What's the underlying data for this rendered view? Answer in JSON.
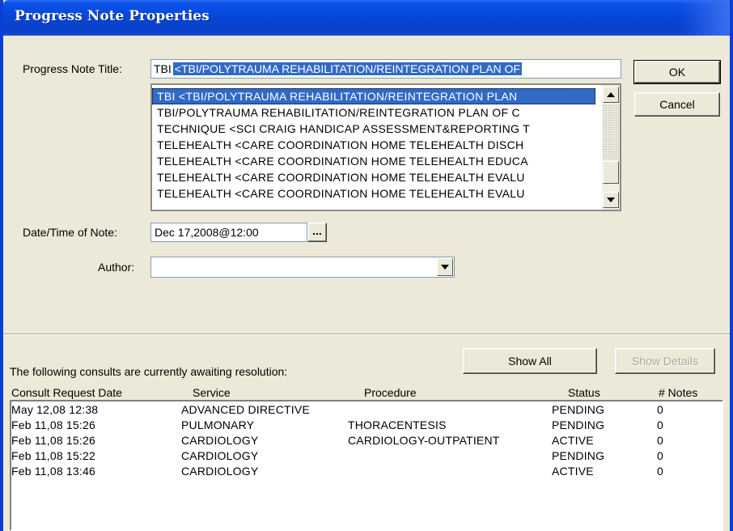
{
  "window": {
    "title": "Progress Note Properties"
  },
  "form": {
    "title_label": "Progress Note Title:",
    "title_typed": "TBI",
    "title_autocomplete": "<TBI/POLYTRAUMA REHABILITATION/REINTEGRATION PLAN OF",
    "title_options": [
      "TBI  <TBI/POLYTRAUMA REHABILITATION/REINTEGRATION PLAN",
      "TBI/POLYTRAUMA REHABILITATION/REINTEGRATION PLAN OF C",
      "TECHNIQUE  <SCI CRAIG HANDICAP ASSESSMENT&REPORTING T",
      "TELEHEALTH  <CARE COORDINATION HOME TELEHEALTH DISCH",
      "TELEHEALTH  <CARE COORDINATION HOME TELEHEALTH EDUCA",
      "TELEHEALTH  <CARE COORDINATION HOME TELEHEALTH EVALU",
      "TELEHEALTH  <CARE COORDINATION HOME TELEHEALTH EVALU"
    ],
    "date_label": "Date/Time of Note:",
    "date_value": "Dec 17,2008@12:00",
    "date_button": "...",
    "author_label": "Author:",
    "author_value": ""
  },
  "buttons": {
    "ok": "OK",
    "cancel": "Cancel",
    "show_all": "Show All",
    "show_details": "Show Details"
  },
  "consults": {
    "caption": "The following consults are currently awaiting resolution:",
    "columns": [
      "Consult Request Date",
      "Service",
      "Procedure",
      "Status",
      "# Notes"
    ],
    "rows": [
      [
        "May 12,08 12:38",
        "ADVANCED DIRECTIVE",
        "",
        "PENDING",
        "0"
      ],
      [
        "Feb 11,08 15:26",
        "PULMONARY",
        "THORACENTESIS",
        "PENDING",
        "0"
      ],
      [
        "Feb 11,08 15:26",
        "CARDIOLOGY",
        "CARDIOLOGY-OUTPATIENT",
        "ACTIVE",
        "0"
      ],
      [
        "Feb 11,08 15:22",
        "CARDIOLOGY",
        "",
        "PENDING",
        "0"
      ],
      [
        "Feb 11,08 13:46",
        "CARDIOLOGY",
        "",
        "ACTIVE",
        "0"
      ]
    ]
  },
  "icons": {
    "scroll_up": "scroll-up-icon",
    "scroll_down": "scroll-down-icon",
    "dropdown": "chevron-down-icon"
  },
  "colors": {
    "selection": "#316ac5",
    "titlebar": "#0a48d8",
    "dialog_bg": "#ece9d8"
  }
}
